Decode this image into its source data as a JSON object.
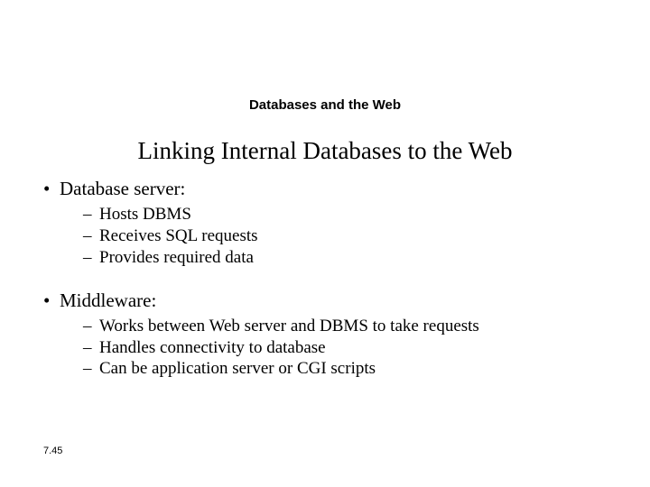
{
  "topic": "Databases and the Web",
  "title": "Linking Internal Databases to the Web",
  "bullets": [
    {
      "label": "Database server:",
      "subs": [
        "Hosts DBMS",
        "Receives SQL requests",
        "Provides required data"
      ]
    },
    {
      "label": "Middleware:",
      "subs": [
        "Works between Web server and DBMS to take requests",
        "Handles connectivity to database",
        "Can be application server or CGI scripts"
      ]
    }
  ],
  "page_number": "7.45"
}
